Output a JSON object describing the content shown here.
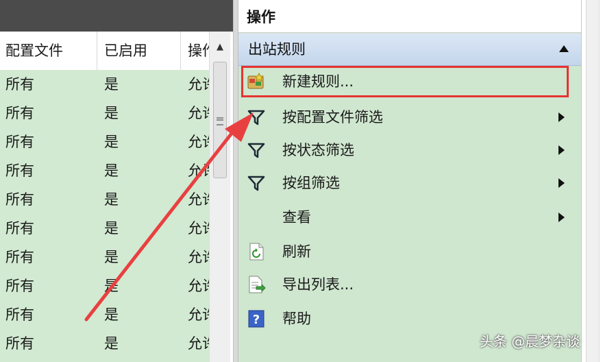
{
  "left_table": {
    "columns": [
      "配置文件",
      "已启用",
      "操作"
    ],
    "rows": [
      [
        "所有",
        "是",
        "允许"
      ],
      [
        "所有",
        "是",
        "允许"
      ],
      [
        "所有",
        "是",
        "允许"
      ],
      [
        "所有",
        "是",
        "允许"
      ],
      [
        "所有",
        "是",
        "允许"
      ],
      [
        "所有",
        "是",
        "允许"
      ],
      [
        "所有",
        "是",
        "允许"
      ],
      [
        "所有",
        "是",
        "允许"
      ],
      [
        "所有",
        "是",
        "允许"
      ],
      [
        "所有",
        "是",
        "允许"
      ]
    ]
  },
  "actions": {
    "title": "操作",
    "section": "出站规则",
    "items": [
      {
        "label": "新建规则...",
        "icon": "new-rule-icon",
        "submenu": false,
        "highlighted": true
      },
      {
        "label": "按配置文件筛选",
        "icon": "filter-icon",
        "submenu": true
      },
      {
        "label": "按状态筛选",
        "icon": "filter-icon",
        "submenu": true
      },
      {
        "label": "按组筛选",
        "icon": "filter-icon",
        "submenu": true
      },
      {
        "label": "查看",
        "icon": "",
        "submenu": true
      },
      {
        "label": "刷新",
        "icon": "refresh-icon",
        "submenu": false
      },
      {
        "label": "导出列表...",
        "icon": "export-list-icon",
        "submenu": false
      },
      {
        "label": "帮助",
        "icon": "help-icon",
        "submenu": false
      }
    ]
  },
  "watermark": "头条 @晨梦杂谈",
  "colors": {
    "row_green": "#d2e9d2",
    "pane_green": "#cfe6cf",
    "highlight_red": "#e53333",
    "annotation_arrow": "#e84040"
  }
}
